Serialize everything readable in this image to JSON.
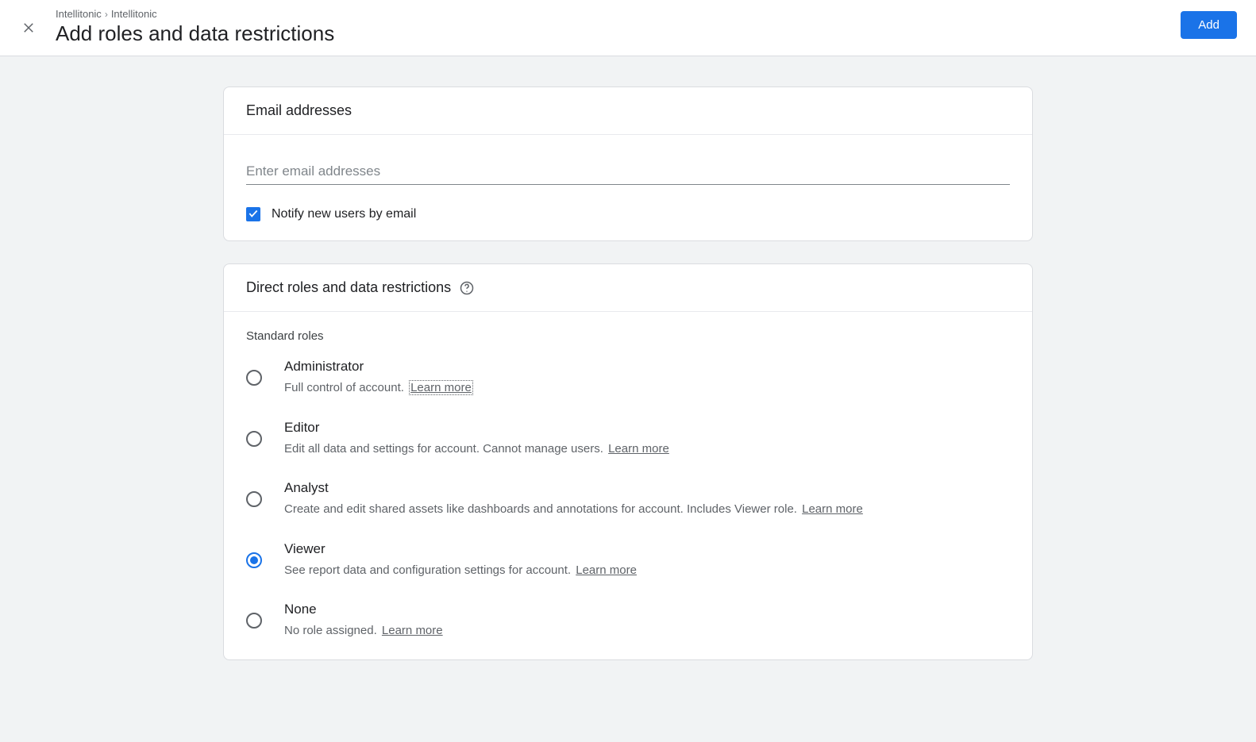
{
  "breadcrumb": {
    "item1": "Intellitonic",
    "item2": "Intellitonic"
  },
  "page_title": "Add roles and data restrictions",
  "add_button": "Add",
  "email_section": {
    "title": "Email addresses",
    "placeholder": "Enter email addresses",
    "notify_label": "Notify new users by email",
    "notify_checked": true
  },
  "roles_section": {
    "title": "Direct roles and data restrictions",
    "subsection": "Standard roles",
    "learn_more": "Learn more",
    "roles": [
      {
        "name": "Administrator",
        "desc": "Full control of account.",
        "selected": false
      },
      {
        "name": "Editor",
        "desc": "Edit all data and settings for account. Cannot manage users.",
        "selected": false
      },
      {
        "name": "Analyst",
        "desc": "Create and edit shared assets like dashboards and annotations for account. Includes Viewer role.",
        "selected": false
      },
      {
        "name": "Viewer",
        "desc": "See report data and configuration settings for account.",
        "selected": true
      },
      {
        "name": "None",
        "desc": "No role assigned.",
        "selected": false
      }
    ]
  }
}
